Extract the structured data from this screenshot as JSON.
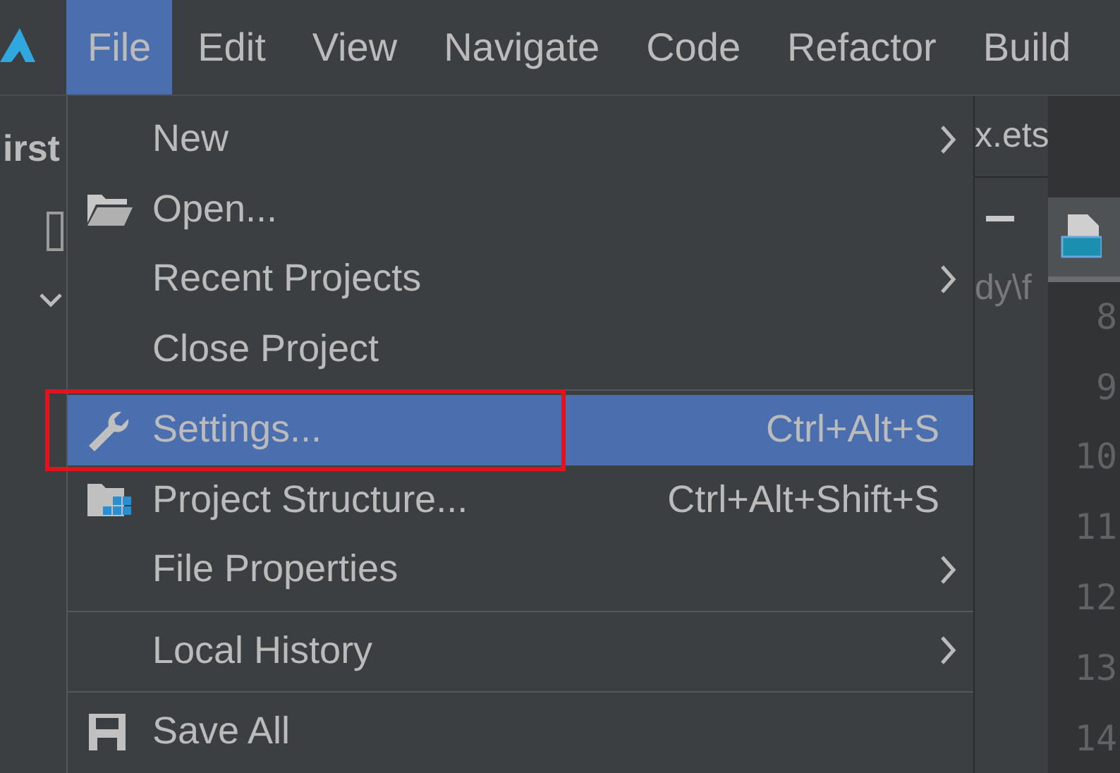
{
  "menubar": {
    "items": [
      {
        "label": "File",
        "selected": true
      },
      {
        "label": "Edit",
        "selected": false
      },
      {
        "label": "View",
        "selected": false
      },
      {
        "label": "Navigate",
        "selected": false
      },
      {
        "label": "Code",
        "selected": false
      },
      {
        "label": "Refactor",
        "selected": false
      },
      {
        "label": "Build",
        "selected": false
      }
    ]
  },
  "project_panel": {
    "title": "irst"
  },
  "file_menu": {
    "items": [
      {
        "kind": "plain",
        "label": "New",
        "submenu": true,
        "selected": false
      },
      {
        "kind": "folder",
        "label": "Open...",
        "selected": false
      },
      {
        "kind": "plain",
        "label": "Recent Projects",
        "submenu": true,
        "selected": false
      },
      {
        "kind": "plain",
        "label": "Close Project",
        "selected": false
      },
      {
        "kind": "separator"
      },
      {
        "kind": "wrench",
        "label": "Settings...",
        "shortcut": "Ctrl+Alt+S",
        "selected": true,
        "framed": true
      },
      {
        "kind": "structure",
        "label": "Project Structure...",
        "shortcut": "Ctrl+Alt+Shift+S",
        "selected": false
      },
      {
        "kind": "plain",
        "label": "File Properties",
        "submenu": true,
        "selected": false
      },
      {
        "kind": "separator"
      },
      {
        "kind": "plain",
        "label": "Local History",
        "submenu": true,
        "selected": false
      },
      {
        "kind": "separator"
      },
      {
        "kind": "save",
        "label": "Save All",
        "selected": false
      }
    ]
  },
  "editor": {
    "tab": "x.ets",
    "path": "dy\\f",
    "line_numbers": [
      "8",
      "9",
      "10",
      "11",
      "12",
      "13",
      "14"
    ]
  }
}
